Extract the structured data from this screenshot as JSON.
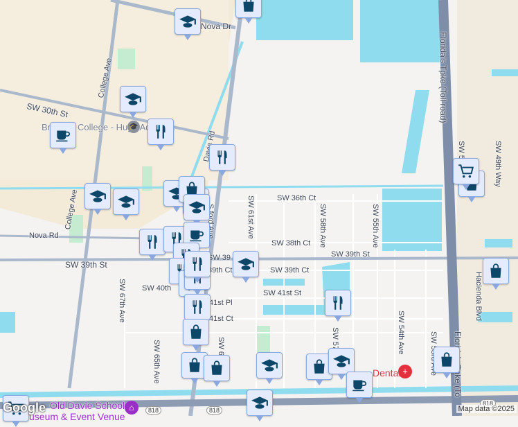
{
  "map": {
    "streets": {
      "nova_dr": "Nova Dr",
      "college_ave": "College Ave",
      "college_ave_2": "College Ave",
      "sw_30th_st": "SW 30th St",
      "davie_rd": "Davie Rd",
      "sw_36th_ct": "SW 36th Ct",
      "sw_61st_ave": "SW 61st Ave",
      "sw_58th_ave": "SW 58th Ave",
      "sw_55th_ave": "SW 55th Ave",
      "tpke_top": "Florida's Tpke (Toll road)",
      "sw_5x": "SW 5",
      "sw_49th_way": "SW 49th Way",
      "nova_rd": "Nova Rd",
      "sw_38th_ct": "SW 38th Ct",
      "sw_39th_st_e": "SW 39th St",
      "sw_39th_st_w": "SW 39th St",
      "sw_39th_ct": "SW 39th Ct",
      "sw_39th_ct_w": "39th Ct",
      "sw_39": "SW 39",
      "sw_40th": "SW 40th",
      "sw_41st_st": "SW 41st St",
      "sw_41st_pl": "41st Pl",
      "sw_41st_ct": "41st Ct",
      "sw_67th_ave": "SW 67th Ave",
      "sw_65th_ave": "SW 65th Ave",
      "sw_6x": "SW 6",
      "sw_54th_ave": "SW 54th Ave",
      "sw_53rd_ave": "SW 53rd Ave",
      "hacienda_blvd": "Hacienda Blvd",
      "tpke_bottom": "Florida's Tpke (To",
      "ford_ave": "S   ford Ave",
      "sw_57": "SW 57"
    },
    "pois": {
      "broward_college": "Broward College - Hugh Adams...",
      "dental": "Dental",
      "old_davie_school": "Old Davie School",
      "old_davie_school_2": "useum & Event Venue"
    },
    "route_shield": "818",
    "google_logo": "Google",
    "attribution": "Map data ©2025",
    "colors": {
      "water": "#8fdcef",
      "road": "#aab8cc",
      "marker_bg": "#e3ebfc",
      "marker_icon": "#0c4668",
      "campus": "#f3ead8",
      "park": "#c5ecd0"
    },
    "markers": [
      "school",
      "shopping",
      "school",
      "school",
      "restaurant",
      "cafe",
      "restaurant",
      "restaurant",
      "school",
      "school",
      "school",
      "shopping",
      "shopping",
      "school",
      "restaurant",
      "cafe",
      "restaurant",
      "restaurant",
      "restaurant",
      "school",
      "restaurant",
      "restaurant",
      "restaurant",
      "shopping",
      "shopping",
      "shopping",
      "school",
      "shopping",
      "school",
      "restaurant",
      "cafe",
      "shopping",
      "grocery",
      "grocery",
      "school",
      "shopping"
    ]
  }
}
